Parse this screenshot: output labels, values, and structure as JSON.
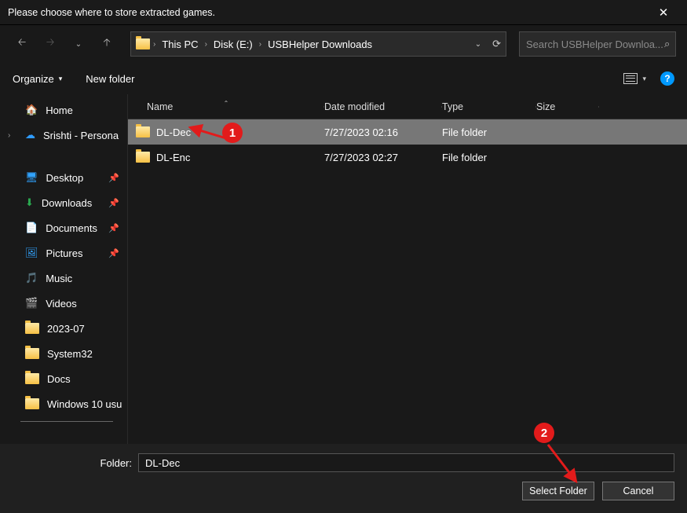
{
  "title": "Please choose where to store extracted games.",
  "breadcrumb": [
    "This PC",
    "Disk (E:)",
    "USBHelper Downloads"
  ],
  "search": {
    "placeholder": "Search USBHelper Downloa..."
  },
  "toolbar": {
    "organize": "Organize",
    "newfolder": "New folder"
  },
  "sidebar": {
    "home": "Home",
    "cloud": "Srishti - Persona",
    "quick": [
      {
        "label": "Desktop",
        "pinned": true
      },
      {
        "label": "Downloads",
        "pinned": true
      },
      {
        "label": "Documents",
        "pinned": true
      },
      {
        "label": "Pictures",
        "pinned": true
      },
      {
        "label": "Music",
        "pinned": false
      },
      {
        "label": "Videos",
        "pinned": false
      },
      {
        "label": "2023-07",
        "pinned": false
      },
      {
        "label": "System32",
        "pinned": false
      },
      {
        "label": "Docs",
        "pinned": false
      },
      {
        "label": "Windows 10 usu",
        "pinned": false
      }
    ]
  },
  "columns": {
    "name": "Name",
    "date": "Date modified",
    "type": "Type",
    "size": "Size"
  },
  "rows": [
    {
      "name": "DL-Dec",
      "date": "7/27/2023 02:16",
      "type": "File folder",
      "selected": true
    },
    {
      "name": "DL-Enc",
      "date": "7/27/2023 02:27",
      "type": "File folder",
      "selected": false
    }
  ],
  "footer": {
    "label": "Folder:",
    "value": "DL-Dec",
    "select": "Select Folder",
    "cancel": "Cancel"
  },
  "annotations": {
    "one": "1",
    "two": "2"
  }
}
